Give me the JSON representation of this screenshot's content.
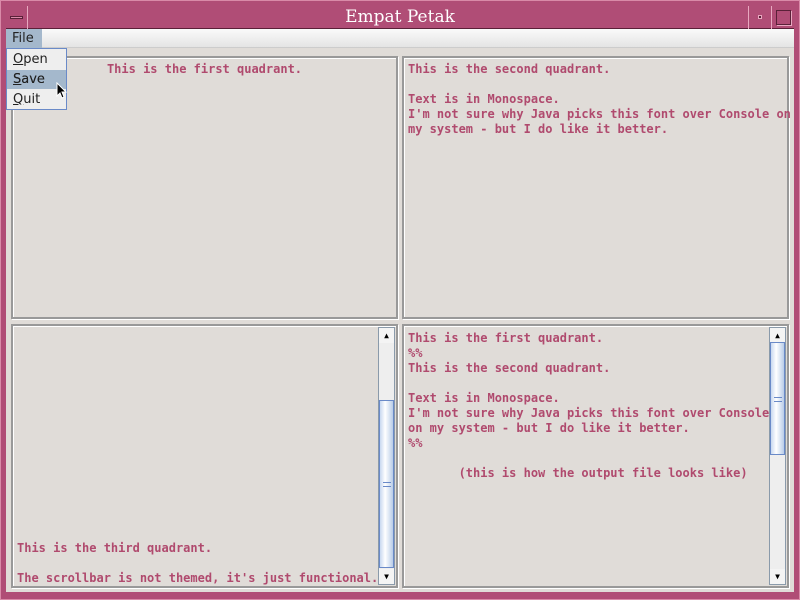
{
  "window": {
    "title": "Empat Petak"
  },
  "menubar": {
    "file": "File"
  },
  "file_menu": {
    "items": [
      {
        "mnemonic": "O",
        "rest": "pen"
      },
      {
        "mnemonic": "S",
        "rest": "ave"
      },
      {
        "mnemonic": "Q",
        "rest": "uit"
      }
    ],
    "selected": "Save"
  },
  "quadrants": {
    "first": "This is the first quadrant.",
    "second": "This is the second quadrant.\n\nText is in Monospace.\nI'm not sure why Java picks this font over Console on\nmy system - but I do like it better.",
    "third": "This is the third quadrant.\n\nThe scrollbar is not themed, it's just functional.",
    "fourth": "This is the first quadrant.\n%%\nThis is the second quadrant.\n\nText is in Monospace.\nI'm not sure why Java picks this font over Console\non my system - but I do like it better.\n%%\n\n       (this is how the output file looks like)"
  },
  "colors": {
    "titlebar": "#b04d76",
    "text": "#b04a6e",
    "menu_selected": "#a4b8cc"
  }
}
